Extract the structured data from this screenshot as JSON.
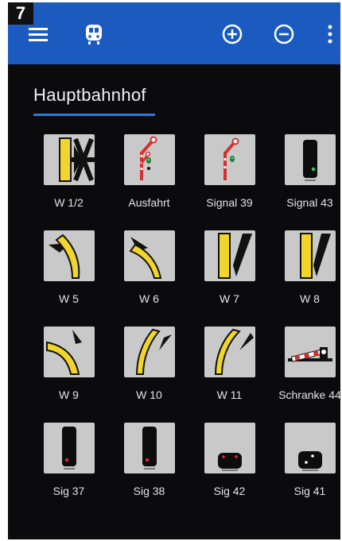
{
  "figure_number": "7",
  "toolbar": {
    "menu_icon": "hamburger-menu-icon",
    "train_icon": "train-icon",
    "zoom_in_icon": "plus-circle-icon",
    "zoom_out_icon": "minus-circle-icon",
    "overflow_icon": "more-vertical-icon"
  },
  "screen": {
    "title": "Hauptbahnhof"
  },
  "colors": {
    "appbar": "#1b5bbf",
    "background": "#0b0b0d",
    "underline": "#2a7de1",
    "tile": "#c9c9c9",
    "track_yellow": "#f2d52a"
  },
  "tiles": [
    {
      "label": "W 1/2",
      "icon": "double-slip-switch-icon"
    },
    {
      "label": "Ausfahrt",
      "icon": "exit-signal-icon"
    },
    {
      "label": "Signal 39",
      "icon": "signal-icon"
    },
    {
      "label": "Signal 43",
      "icon": "light-signal-icon"
    },
    {
      "label": "W 5",
      "icon": "left-curve-switch-icon"
    },
    {
      "label": "W 6",
      "icon": "left-curve-switch-icon"
    },
    {
      "label": "W 7",
      "icon": "straight-switch-icon"
    },
    {
      "label": "W 8",
      "icon": "straight-switch-icon"
    },
    {
      "label": "W 9",
      "icon": "left-curve-switch-icon"
    },
    {
      "label": "W 10",
      "icon": "right-curve-switch-icon"
    },
    {
      "label": "W 11",
      "icon": "right-curve-switch-icon"
    },
    {
      "label": "Schranke 44",
      "icon": "level-crossing-barrier-icon"
    },
    {
      "label": "Sig 37",
      "icon": "light-signal-red-icon"
    },
    {
      "label": "Sig 38",
      "icon": "light-signal-red-icon"
    },
    {
      "label": "Sig 42",
      "icon": "dwarf-signal-red-icon"
    },
    {
      "label": "Sig 41",
      "icon": "dwarf-signal-white-icon"
    }
  ]
}
